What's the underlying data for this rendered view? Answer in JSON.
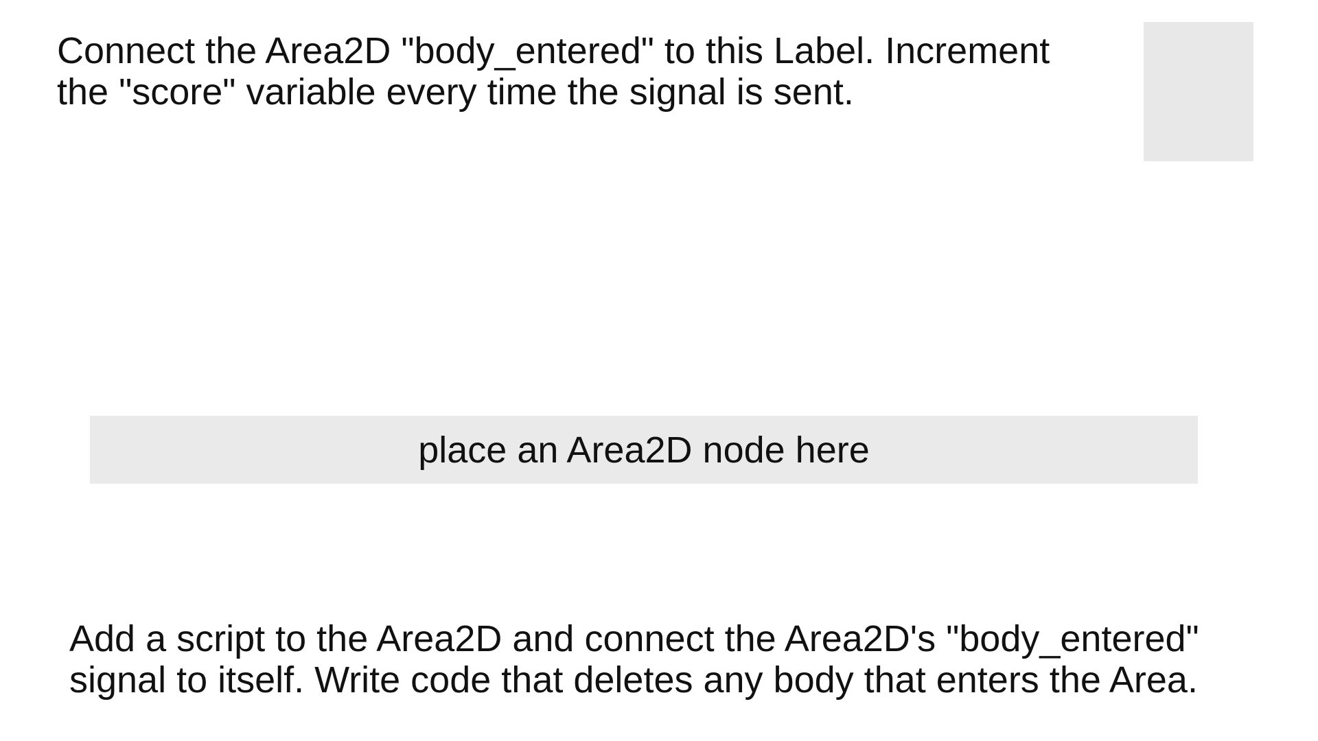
{
  "top_instruction": {
    "line1": "Connect the Area2D \"body_entered\" to this Label. Increment",
    "line2": "the \"score\" variable every time the signal is sent."
  },
  "score_label": {
    "text": ""
  },
  "area_placeholder": {
    "text": "place an Area2D node here"
  },
  "bottom_instruction": {
    "line1": "Add a script to the Area2D and connect the Area2D's \"body_entered\"",
    "line2": "signal to itself. Write code that deletes any body that enters the Area."
  },
  "colors": {
    "background": "#ffffff",
    "panel": "#e8e8e8",
    "text": "#111111"
  }
}
